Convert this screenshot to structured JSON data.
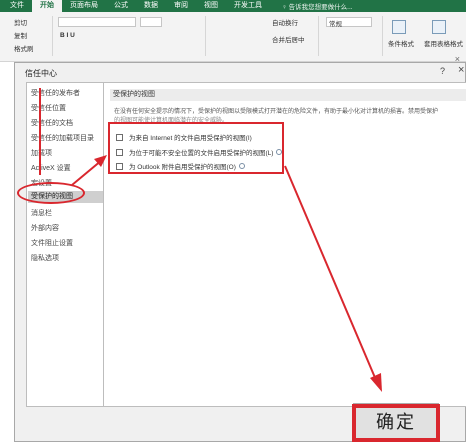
{
  "ribbon": {
    "tabs": [
      "文件",
      "开始",
      "页面布局",
      "公式",
      "数据",
      "审阅",
      "视图",
      "开发工具"
    ],
    "active_tab": "开始",
    "tell_me": "♀ 告诉我您想要做什么...",
    "clipboard": [
      "剪切",
      "复制",
      "格式刷"
    ],
    "wrap_text": "自动换行",
    "merge_center": "合并后居中",
    "general": "常规",
    "cond_format": "条件格式",
    "table_format": "套用表格格式"
  },
  "dialog": {
    "title": "信任中心",
    "help": "?",
    "close": "×",
    "nav": [
      "受信任的发布者",
      "受信任位置",
      "受信任的文档",
      "受信任的加载项目录",
      "加载项",
      "ActiveX 设置",
      "宏设置",
      "受保护的视图",
      "消息栏",
      "外部内容",
      "文件阻止设置",
      "隐私选项"
    ],
    "section_title": "受保护的视图",
    "description": [
      "在没有任何安全提示的情况下，受保护的视图以受限模式打开潜在的危险文件，有助于最小化对计算机的损害。禁用受保护",
      "的视图可能使计算机面临潜在的安全威胁。"
    ],
    "options": [
      "为来自 Internet 的文件启用受保护的视图(I)",
      "为位于可能不安全位置的文件启用受保护的视图(L)",
      "为 Outlook 附件启用受保护的视图(O)"
    ],
    "ok_label": "确定"
  },
  "colors": {
    "excel_green": "#217346",
    "annotation_red": "#d9272e"
  }
}
